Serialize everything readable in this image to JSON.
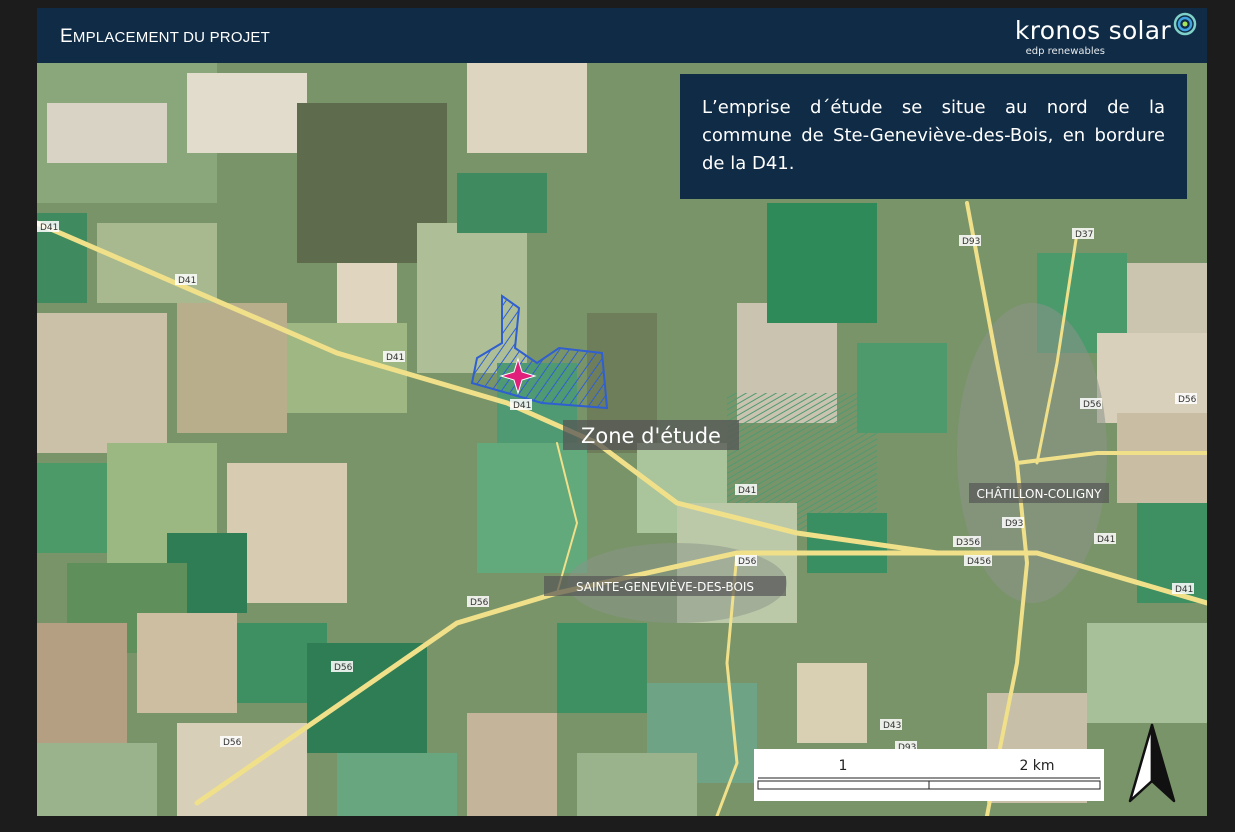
{
  "header": {
    "title_first_letter": "E",
    "title_rest": "MPLACEMENT DU PROJET",
    "logo_text": "kronos solar",
    "logo_subtext": "edp renewables"
  },
  "info": {
    "text": "L’emprise d´étude se situe au nord de la commune de Ste-Geneviève-des-Bois, en bordure de la D41."
  },
  "map": {
    "zone_label": "Zone d'étude",
    "towns": [
      "CHÂTILLON-COLIGNY",
      "SAINTE-GENEVIÈVE-DES-BOIS"
    ],
    "road_labels": [
      "D41",
      "D41",
      "D41",
      "D41",
      "D41",
      "D41",
      "D41",
      "D93",
      "D37",
      "D56",
      "D56",
      "D56",
      "D56",
      "D56",
      "D56",
      "D356",
      "D456",
      "D93",
      "D43",
      "D93"
    ],
    "colors": {
      "study_zone": "#2f5fd0",
      "marker": "#e0207a",
      "road": "#f0e08a",
      "label_bg": "#555555"
    }
  },
  "scale": {
    "label_1": "1",
    "label_2": "2 km"
  }
}
